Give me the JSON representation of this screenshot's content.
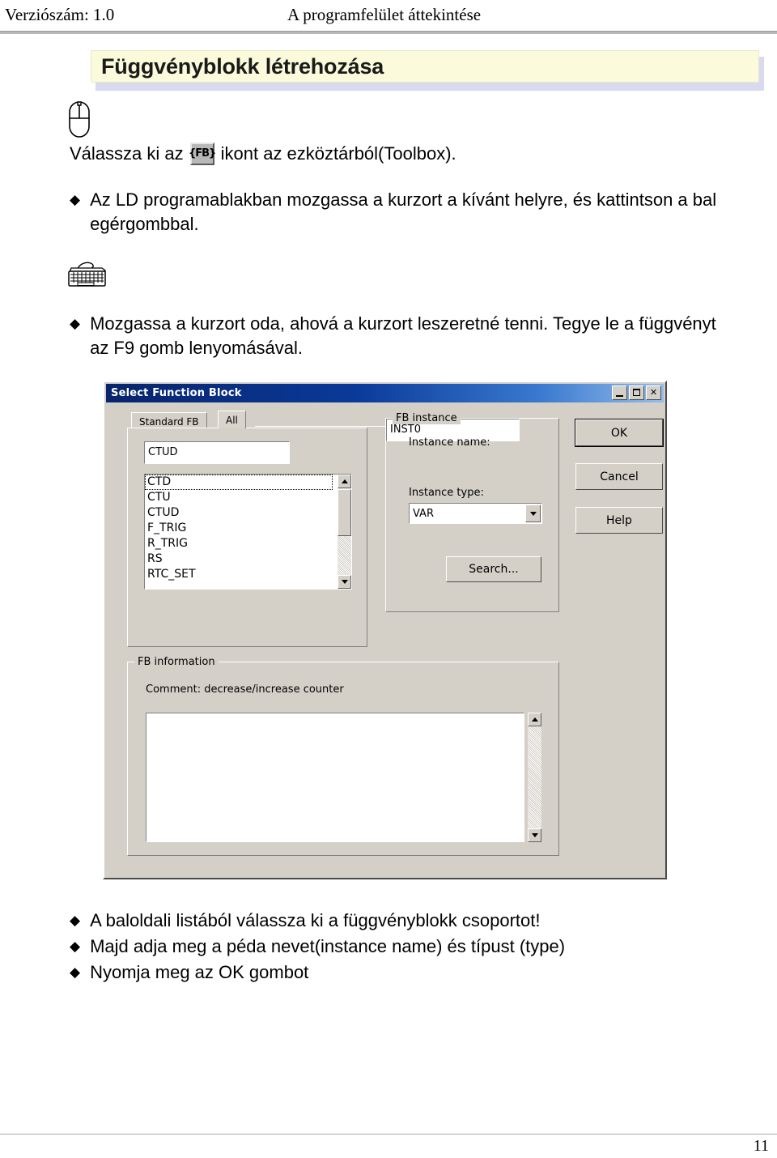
{
  "header": {
    "left": "Verziószám: 1.0",
    "center": "A programfelület áttekintése"
  },
  "title_banner": {
    "text": "Függvényblokk létrehozása"
  },
  "mouse_section": {
    "icon": "mouse-icon",
    "line_before": "Válassza ki az",
    "toolbar_button_label": "{FB}",
    "line_after": "ikont az ezköztárból(Toolbox).",
    "bullets": [
      "Az LD programablakban mozgassa a kurzort a kívánt helyre, és kattintson a bal egérgombbal."
    ]
  },
  "keyboard_section": {
    "icon": "keyboard-icon",
    "bullets": [
      "Mozgassa a kurzort oda, ahová a kurzort leszeretné tenni. Tegye le a függvényt az F9 gomb lenyomásával."
    ]
  },
  "dialog": {
    "title": "Select Function Block",
    "titlebar_buttons": {
      "minimize": "minimize-icon",
      "maximize": "maximize-icon",
      "close": "✕"
    },
    "tabs": [
      {
        "label": "Standard FB",
        "active": false
      },
      {
        "label": "All",
        "active": true
      }
    ],
    "fb_name_value": "CTUD",
    "fb_list": [
      "CTD",
      "CTU",
      "CTUD",
      "F_TRIG",
      "R_TRIG",
      "RS",
      "RTC_SET"
    ],
    "fb_list_focused": "CTD",
    "fb_instance": {
      "legend": "FB instance",
      "instance_name_label": "Instance name:",
      "instance_name_value": "INST0",
      "instance_type_label": "Instance type:",
      "instance_type_value": "VAR",
      "search_button": "Search..."
    },
    "fb_information": {
      "legend": "FB information",
      "comment_label": "Comment: decrease/increase counter",
      "comment_value": ""
    },
    "buttons": {
      "ok": "OK",
      "cancel": "Cancel",
      "help": "Help"
    }
  },
  "bottom_bullets": [
    "A baloldali listából válassza ki a függvényblokk csoportot!",
    "Majd adja meg a péda nevet(instance name) és típust (type)",
    "Nyomja meg az OK gombot"
  ],
  "footer": {
    "page_number": "11"
  },
  "colors": {
    "title_banner_bg": "#fbfbdc",
    "title_banner_shadow": "#d9d9ef",
    "dialog_face": "#d4d0c8",
    "titlebar_start": "#08246b",
    "titlebar_end": "#96bcea"
  },
  "glyphs": {
    "diamond": "◆"
  }
}
